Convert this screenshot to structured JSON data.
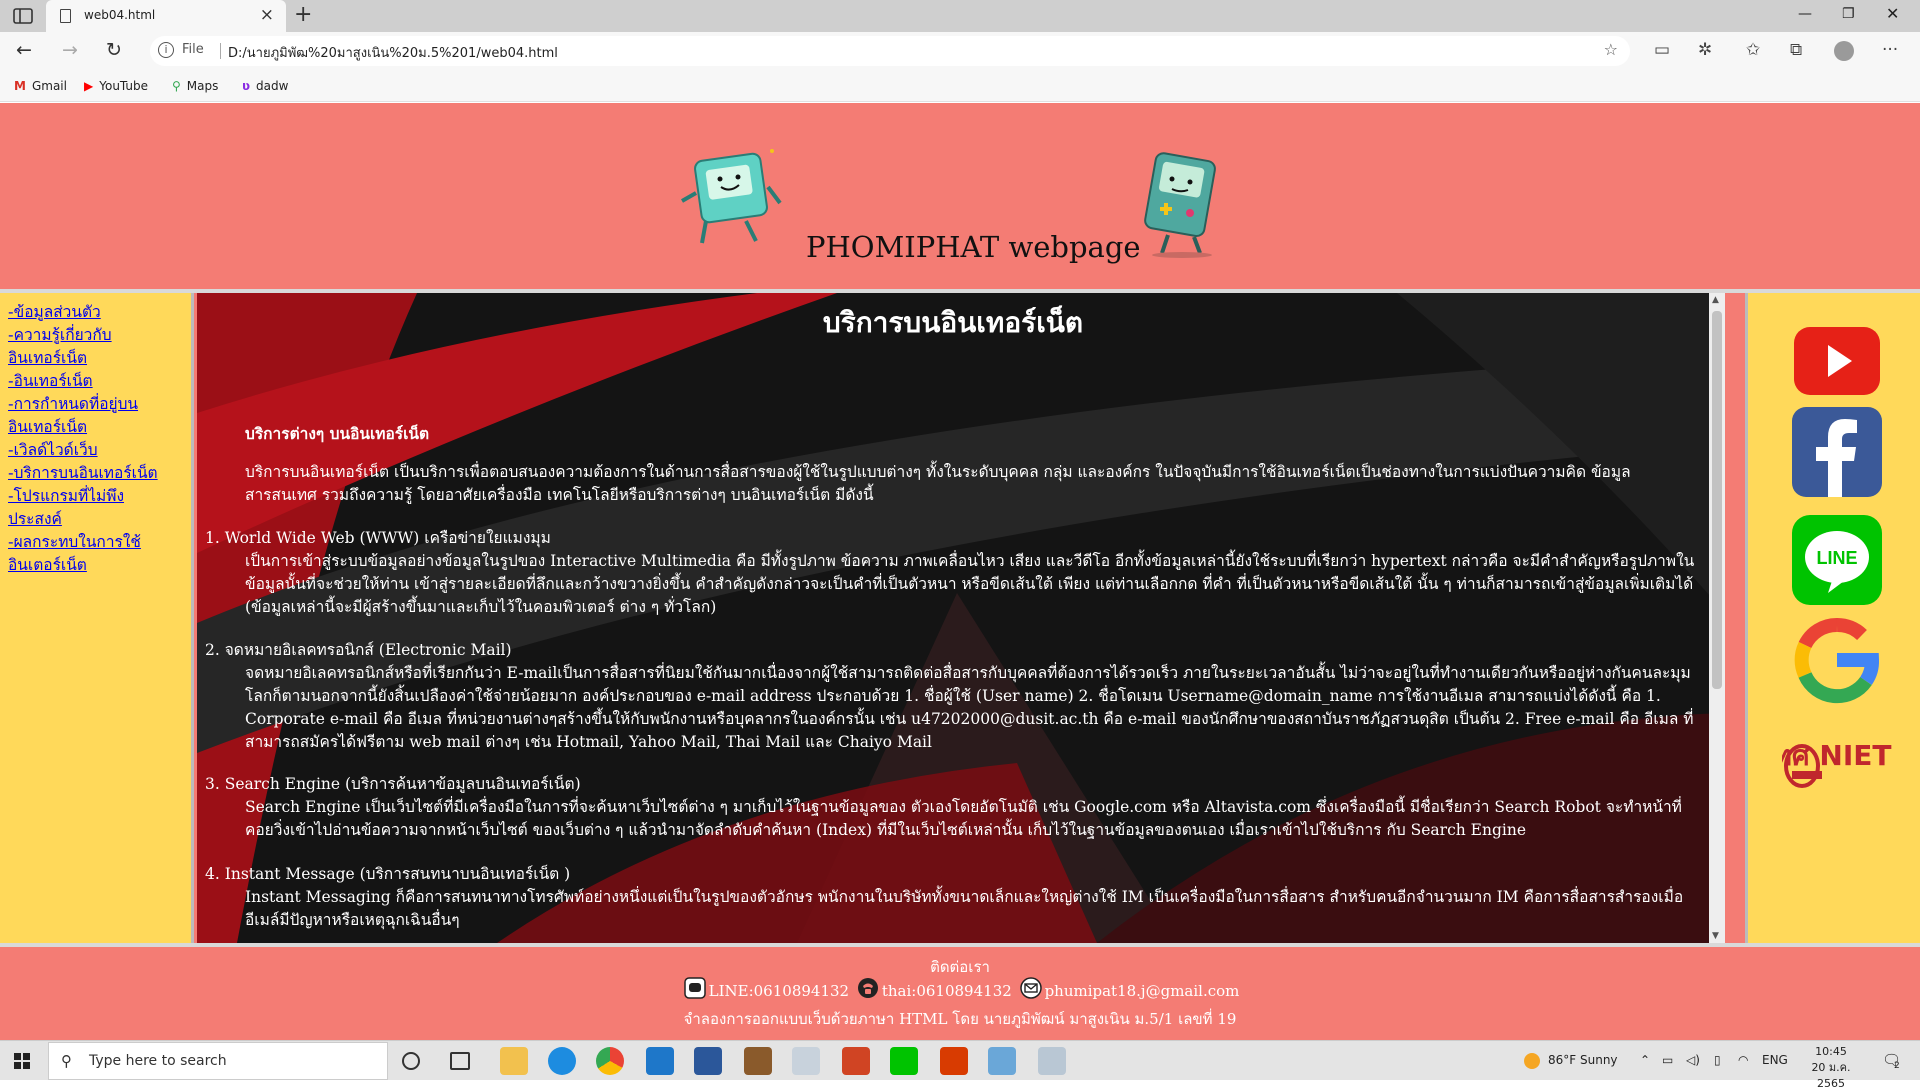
{
  "browser": {
    "tab_title": "web04.html",
    "new_tab": "+",
    "address_prefix": "File",
    "address": "D:/นายภูมิพัฒ%20มาสูงเนิน%20ม.5%201/web04.html",
    "bookmarks": [
      {
        "label": "Gmail",
        "icon": "gmail-icon",
        "color": "#d93025"
      },
      {
        "label": "YouTube",
        "icon": "youtube-icon",
        "color": "#ff0000"
      },
      {
        "label": "Maps",
        "icon": "maps-pin-icon",
        "color": "#34a853"
      },
      {
        "label": "dadw",
        "icon": "page-icon",
        "color": "#8a2be2"
      }
    ]
  },
  "header": {
    "site_title": "PHOMIPHAT webpage"
  },
  "sidebar": {
    "items": [
      {
        "label": "-ข้อมูลส่วนตัว"
      },
      {
        "label": "-ความรู้เกี่ยวกับ"
      },
      {
        "label": "อินเทอร์เน็ต"
      },
      {
        "label": "-อินเทอร์เน็ต"
      },
      {
        "label": "-การกำหนดที่อยู่บน"
      },
      {
        "label": "อินเทอร์เน็ต"
      },
      {
        "label": "-เวิลด์ไวด์เว็บ"
      },
      {
        "label": "-บริการบนอินเทอร์เน็ต"
      },
      {
        "label": "-โปรแกรมที่ไม่พึง"
      },
      {
        "label": "ประสงค์"
      },
      {
        "label": "-ผลกระทบในการใช้"
      },
      {
        "label": "อินเตอร์เน็ต"
      }
    ]
  },
  "main": {
    "heading": "บริการบนอินเทอร์เน็ต",
    "subheading": "บริการต่างๆ บนอินเทอร์เน็ต",
    "intro": "บริการบนอินเทอร์เน็ต เป็นบริการเพื่อตอบสนองความต้องการในด้านการสื่อสารของผู้ใช้ในรูปแบบต่างๆ ทั้งในระดับบุคคล กลุ่ม และองค์กร ในปัจจุบันมีการใช้อินเทอร์เน็ตเป็นช่องทางในการแบ่งปันความคิด ข้อมูล สารสนเทศ รวมถึงความรู้ โดยอาศัยเครื่องมือ เทคโนโลยีหรือบริการต่างๆ บนอินเทอร์เน็ต มีดังนี้",
    "services": [
      {
        "head": "1. World Wide Web (WWW) เครือข่ายใยแมงมุม",
        "body": "เป็นการเข้าสู่ระบบข้อมูลอย่างข้อมูลในรูปของ Interactive Multimedia คือ มีทั้งรูปภาพ ข้อความ ภาพเคลื่อนไหว เสียง และวีดีโอ อีกทั้งข้อมูลเหล่านี้ยังใช้ระบบที่เรียกว่า hypertext กล่าวคือ จะมีคำสำคัญหรือรูปภาพในข้อมูลนั้นที่จะช่วยให้ท่าน เข้าสู่รายละเอียดที่ลึกและกว้างขวางยิ่งขึ้น คำสำคัญดังกล่าวจะเป็นคำที่เป็นตัวหนา หรือขีดเส้นใต้ เพียง แต่ท่านเลือกกด ที่คำ ที่เป็นตัวหนาหรือขีดเส้นใต้ นั้น ๆ ท่านก็สามารถเข้าสู่ข้อมูลเพิ่มเติมได้ (ข้อมูลเหล่านี้จะมีผู้สร้างขึ้นมาและเก็บไว้ในคอมพิวเตอร์ ต่าง ๆ ทั่วโลก)"
      },
      {
        "head": "2. จดหมายอิเลคทรอนิกส์ (Electronic Mail)",
        "body": "จดหมายอิเลคทรอนิกส์หรือที่เรียกกันว่า E-mailเป็นการสื่อสารที่นิยมใช้กันมากเนื่องจากผู้ใช้สามารถติดต่อสื่อสารกับบุคคลที่ต้องการได้รวดเร็ว ภายในระยะเวลาอันสั้น ไม่ว่าจะอยู่ในที่ทำงานเดียวกันหรืออยู่ห่างกันคนละมุมโลกก็ตามนอกจากนี้ยังสิ้นเปลืองค่าใช้จ่ายน้อยมาก องค์ประกอบของ e-mail address ประกอบด้วย 1. ชื่อผู้ใช้ (User name) 2. ชื่อโดเมน Username@domain_name การใช้งานอีเมล สามารถแบ่งได้ดังนี้ คือ 1. Corporate e-mail คือ อีเมล ที่หน่วยงานต่างๆสร้างขึ้นให้กับพนักงานหรือบุคลากรในองค์กรนั้น เช่น u47202000@dusit.ac.th คือ e-mail ของนักศึกษาของสถาบันราชภัฏสวนดุสิต เป็นต้น 2. Free e-mail คือ อีเมล ที่สามารถสมัครได้ฟรีตาม web mail ต่างๆ เช่น Hotmail, Yahoo Mail, Thai Mail และ Chaiyo Mail"
      },
      {
        "head": "3. Search Engine (บริการค้นหาข้อมูลบนอินเทอร์เน็ต)",
        "body": "Search Engine เป็นเว็บไซต์ที่มีเครื่องมือในการที่จะค้นหาเว็บไซต์ต่าง ๆ มาเก็บไว้ในฐานข้อมูลของ ตัวเองโดยอัตโนมัติ เช่น Google.com หรือ Altavista.com ซึ่งเครื่องมือนี้ มีชื่อเรียกว่า Search Robot จะทำหน้าที่คอยวิ่งเข้าไปอ่านข้อความจากหน้าเว็บไซต์ ของเว็บต่าง ๆ แล้วนำมาจัดลำดับคำค้นหา (Index) ที่มีในเว็บไซต์เหล่านั้น เก็บไว้ในฐานข้อมูลของตนเอง เมื่อเราเข้าไปใช้บริการ กับ Search Engine"
      },
      {
        "head": "4. Instant Message (บริการสนทนาบนอินเทอร์เน็ต )",
        "body": "Instant Messaging ก็คือการสนทนาทางโทรศัพท์อย่างหนึ่งแต่เป็นในรูปของตัวอักษร พนักงานในบริษัททั้งขนาดเล็กและใหญ่ต่างใช้ IM เป็นเครื่องมือในการสื่อสาร สำหรับคนอีกจำนวนมาก IM คือการสื่อสารสำรองเมื่ออีเมล์มีปัญหาหรือเหตุฉุกเฉินอื่นๆ"
      }
    ]
  },
  "social": [
    {
      "icon": "youtube-icon",
      "color": "#e62117"
    },
    {
      "icon": "facebook-icon",
      "color": "#3b5998"
    },
    {
      "icon": "line-icon",
      "color": "#00c300"
    },
    {
      "icon": "google-icon",
      "color": "#4285f4"
    },
    {
      "icon": "niets-logo",
      "color": "#c0272d",
      "text": "สทศ NIETS"
    }
  ],
  "footer": {
    "contact": "ติดต่อเรา",
    "line": "LINE:0610894132",
    "phone": "thai:0610894132",
    "email": "phumipat18.j@gmail.com",
    "credit": "จำลองการออกแบบเว็บด้วยภาษา HTML โดย นายภูมิพัฒน์ มาสูงเนิน ม.5/1 เลขที่ 19"
  },
  "taskbar": {
    "search_placeholder": "Type here to search",
    "weather": "86°F  Sunny",
    "lang": "ENG",
    "time": "10:45",
    "date": "20 ม.ค. 2565",
    "notification_count": "2"
  },
  "colors": {
    "page_bg": "#f47c74",
    "sidebar_bg": "#ffd95a",
    "main_bg": "#151515",
    "accent_red": "#b5121b"
  }
}
